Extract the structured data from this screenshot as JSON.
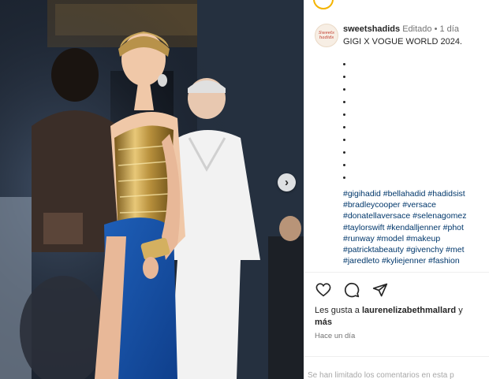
{
  "post": {
    "username": "sweetshadids",
    "edited": "Editado",
    "separator": "•",
    "time_ago": "1 día",
    "title": "GIGI X VOGUE WORLD 2024.",
    "avatar_text": "Sweets\nhadids",
    "hashtags": [
      "#gigihadid #bellahadid #hadidsist",
      "#bradleycooper #versace",
      "#donatellaversace #selenagomez",
      "#taylorswift #kendalljenner #phot",
      "#runway #model #makeup",
      "#patricktabeauty #givenchy #met",
      "#jaredleto #kyliejenner #fashion"
    ]
  },
  "likes": {
    "prefix": "Les gusta a",
    "user": "laurenelizabethmallard",
    "connector": "y",
    "more": "más"
  },
  "timestamp": "Hace un día",
  "comments_notice": "Se han limitado los comentarios en esta p",
  "photo": {
    "next_button": "›"
  },
  "icons": [
    "heart-icon",
    "comment-icon",
    "share-icon",
    "chevron-right-icon"
  ],
  "colors": {
    "hashtag": "#00376b",
    "meta": "#737373",
    "story_ring": "#f4b400"
  }
}
